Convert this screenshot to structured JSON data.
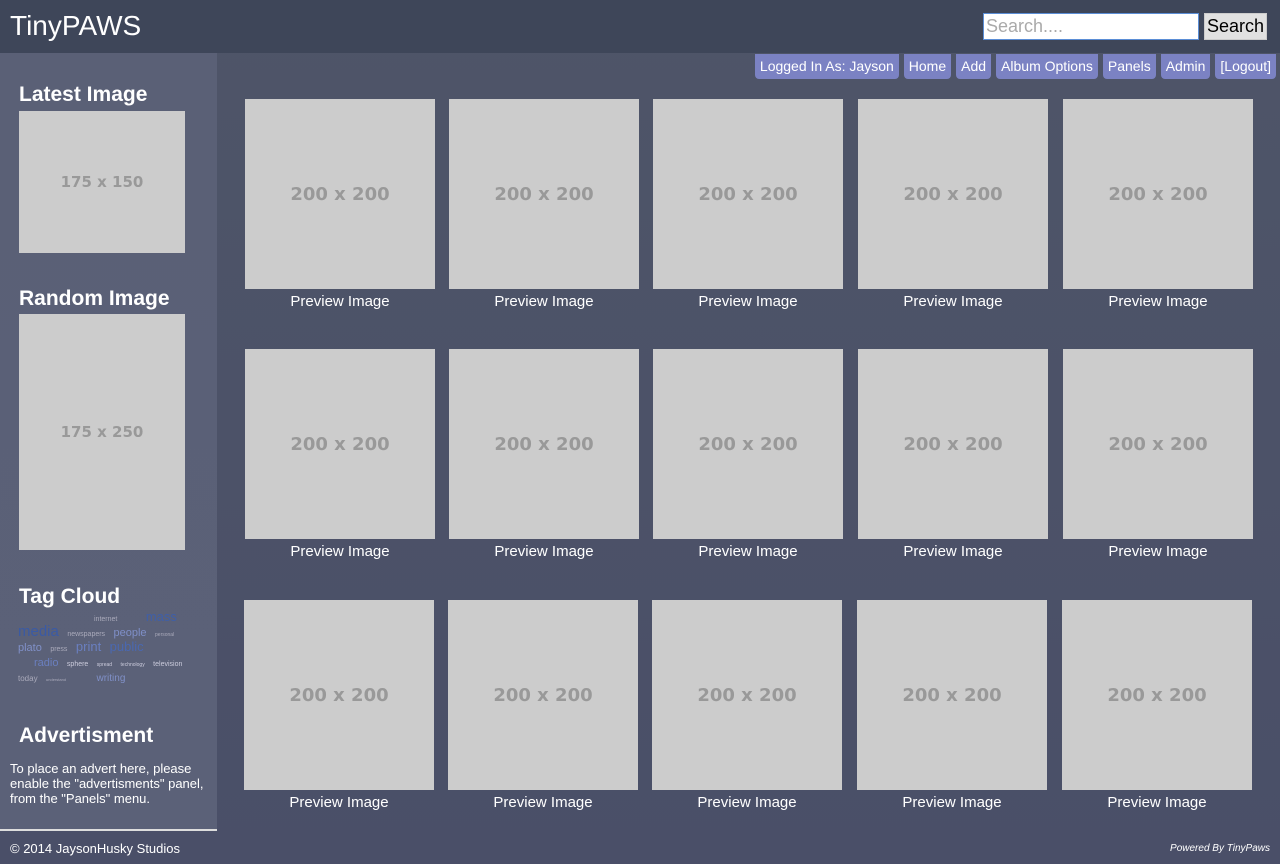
{
  "header": {
    "title": "TinyPAWS",
    "search_placeholder": "Search....",
    "search_button": "Search"
  },
  "nav": [
    "Logged In As: Jayson",
    "Home",
    "Add",
    "Album Options",
    "Panels",
    "Admin",
    "[Logout]"
  ],
  "sidebar": {
    "latest_title": "Latest Image",
    "latest_placeholder": "175 x 150",
    "random_title": "Random Image",
    "random_placeholder": "175 x 250",
    "tagcloud_title": "Tag Cloud",
    "tags": [
      "internet",
      "mass",
      "media",
      "newspapers",
      "people",
      "personal",
      "plato",
      "press",
      "print",
      "public",
      "radio",
      "sphere",
      "spread",
      "technology",
      "television",
      "today",
      "understand",
      "writing"
    ],
    "advert_title": "Advertisment",
    "advert_text": "To place an advert here, please enable the \"advertisments\" panel, from the \"Panels\" menu."
  },
  "gallery": {
    "placeholder": "200 x 200",
    "caption": "Preview Image",
    "count": 15
  },
  "footer": {
    "copyright": "© 2014 JaysonHusky Studios",
    "powered": "Powered By TinyPaws"
  }
}
